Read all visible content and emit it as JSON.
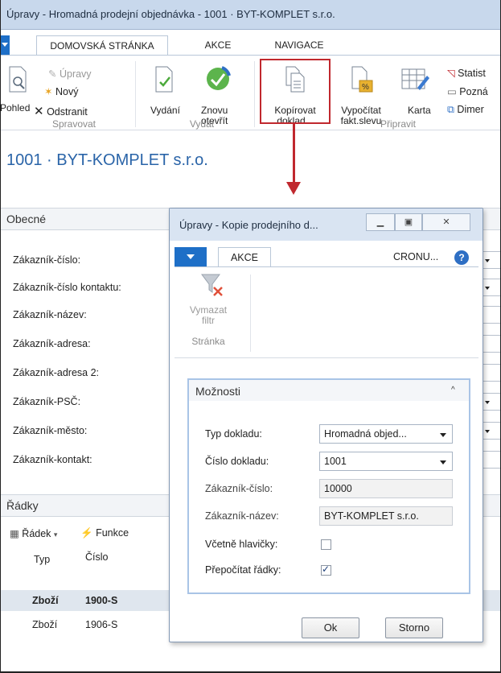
{
  "window": {
    "title": "Úpravy - Hromadná prodejní objednávka - 1001 · BYT-KOMPLET s.r.o."
  },
  "ribbon": {
    "tabs": [
      "DOMOVSKÁ STRÁNKA",
      "AKCE",
      "NAVIGACE"
    ],
    "spravovat": {
      "view": "Pohled",
      "edit": "Úpravy",
      "new": "Nový",
      "delete": "Odstranit",
      "group": "Spravovat"
    },
    "vydat": {
      "release": "Vydání",
      "reopen_1": "Znovu",
      "reopen_2": "otevřít",
      "group": "Vydat"
    },
    "pripravit": {
      "copy_1": "Kopírovat",
      "copy_2": "doklad...",
      "calc_1": "Vypočítat",
      "calc_2": "fakt.slevu",
      "card": "Karta",
      "stats": "Statist",
      "notes": "Pozná",
      "dims": "Dimer",
      "group": "Připravit"
    }
  },
  "page": {
    "title": "1001 · BYT-KOMPLET s.r.o.",
    "general_section": "Obecné",
    "fields": [
      "Zákazník-číslo:",
      "Zákazník-číslo kontaktu:",
      "Zákazník-název:",
      "Zákazník-adresa:",
      "Zákazník-adresa 2:",
      "Zákazník-PSČ:",
      "Zákazník-město:",
      "Zákazník-kontakt:"
    ],
    "lines_section": "Řádky",
    "lines_toolbar": {
      "row": "Řádek",
      "functions": "Funkce"
    },
    "columns": {
      "type": "Typ",
      "number": "Číslo"
    },
    "rows": [
      {
        "type": "Zboží",
        "number": "1900-S"
      },
      {
        "type": "Zboží",
        "number": "1906-S"
      }
    ]
  },
  "dialog": {
    "title": "Úpravy - Kopie prodejního d...",
    "tab": "AKCE",
    "company": "CRONU...",
    "clear_filter_1": "Vymazat",
    "clear_filter_2": "filtr",
    "group": "Stránka",
    "options_header": "Možnosti",
    "doc_type_label": "Typ dokladu:",
    "doc_type_value": "Hromadná objed...",
    "doc_no_label": "Číslo dokladu:",
    "doc_no_value": "1001",
    "cust_no_label": "Zákazník-číslo:",
    "cust_no_value": "10000",
    "cust_name_label": "Zákazník-název:",
    "cust_name_value": "BYT-KOMPLET s.r.o.",
    "include_header_label": "Včetně hlavičky:",
    "include_header": false,
    "recalc_lines_label": "Přepočítat řádky:",
    "recalc_lines": true,
    "ok": "Ok",
    "cancel": "Storno"
  },
  "colors": {
    "accent": "#1e6fc7",
    "highlight": "#c0282e",
    "title": "#2a64a8"
  }
}
